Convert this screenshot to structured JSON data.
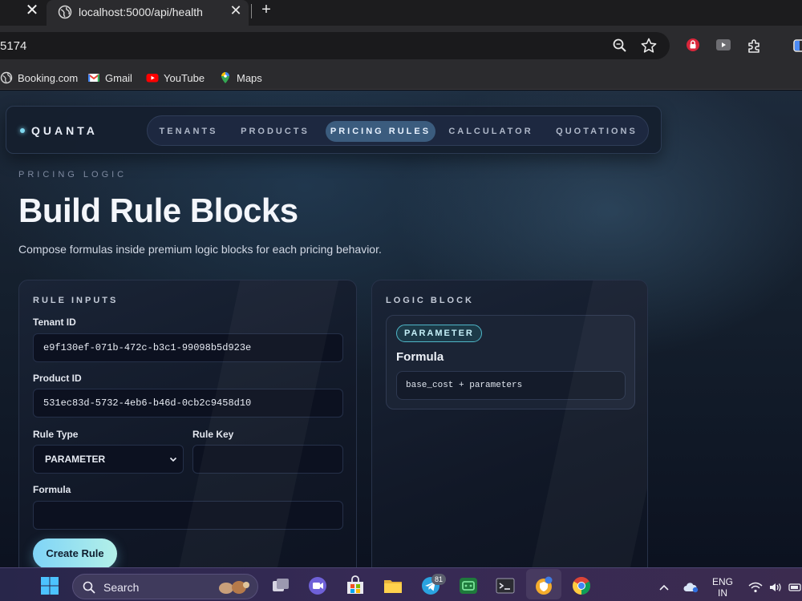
{
  "browser": {
    "tab_title": "localhost:5000/api/health",
    "url": "5174",
    "bookmarks": [
      "Booking.com",
      "Gmail",
      "YouTube",
      "Maps"
    ]
  },
  "app": {
    "brand": "QUANTA",
    "nav": [
      "TENANTS",
      "PRODUCTS",
      "PRICING RULES",
      "CALCULATOR",
      "QUOTATIONS"
    ],
    "active_nav": "PRICING RULES"
  },
  "hero": {
    "eyebrow": "PRICING LOGIC",
    "title": "Build Rule Blocks",
    "subtitle": "Compose formulas inside premium logic blocks for each pricing behavior."
  },
  "rule_inputs": {
    "label": "RULE INPUTS",
    "tenant_id_label": "Tenant ID",
    "tenant_id_value": "e9f130ef-071b-472c-b3c1-99098b5d923e",
    "product_id_label": "Product ID",
    "product_id_value": "531ec83d-5732-4eb6-b46d-0cb2c9458d10",
    "rule_type_label": "Rule Type",
    "rule_type_value": "PARAMETER",
    "rule_key_label": "Rule Key",
    "rule_key_value": "",
    "formula_label": "Formula",
    "formula_value": "",
    "create_button": "Create Rule"
  },
  "logic_block": {
    "label": "LOGIC BLOCK",
    "badge": "PARAMETER",
    "formula_title": "Formula",
    "formula": "base_cost + parameters"
  },
  "taskbar": {
    "search_label": "Search",
    "telegram_badge": "81",
    "language": "ENG",
    "region": "IN"
  },
  "colors": {
    "accent": "#7fd4f7",
    "active_nav_bg": "#3b5c7e",
    "page_bg": "#15202e"
  }
}
